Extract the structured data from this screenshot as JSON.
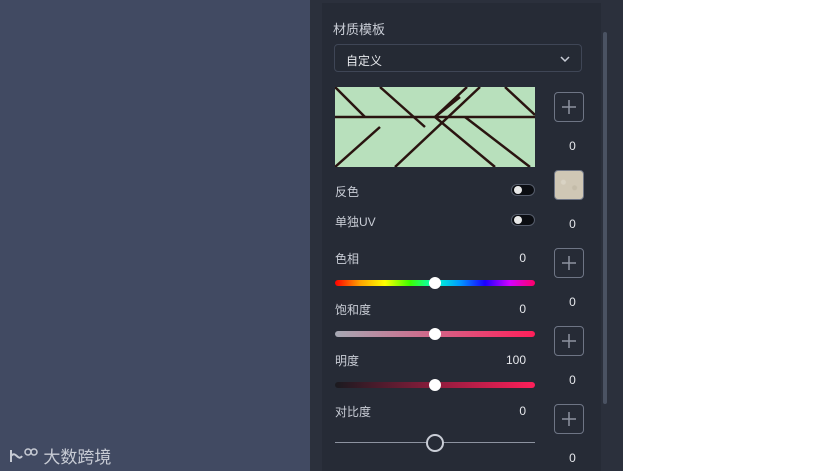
{
  "panel": {
    "title": "材质模板",
    "template_value": "自定义",
    "invert_label": "反色",
    "single_uv_label": "单独UV",
    "hue": {
      "label": "色相",
      "value": "0",
      "level": 0.5
    },
    "saturation": {
      "label": "饱和度",
      "value": "0",
      "level": 0.5
    },
    "brightness": {
      "label": "明度",
      "value": "100",
      "level": 0.5
    },
    "contrast": {
      "label": "对比度",
      "value": "0",
      "level": 0.5
    }
  },
  "side": {
    "numbers": [
      "0",
      "0",
      "0",
      "0",
      "0"
    ]
  },
  "watermark": "大数跨境",
  "colors": {
    "preview_bg": "#b8e0bc",
    "preview_lines": "#2a1410",
    "saturation_start": "#a6a9b4",
    "saturation_end": "#ff1f5a",
    "brightness_end": "#ff1f5a"
  },
  "icons": [
    "chevron-down-icon",
    "plus-icon"
  ]
}
